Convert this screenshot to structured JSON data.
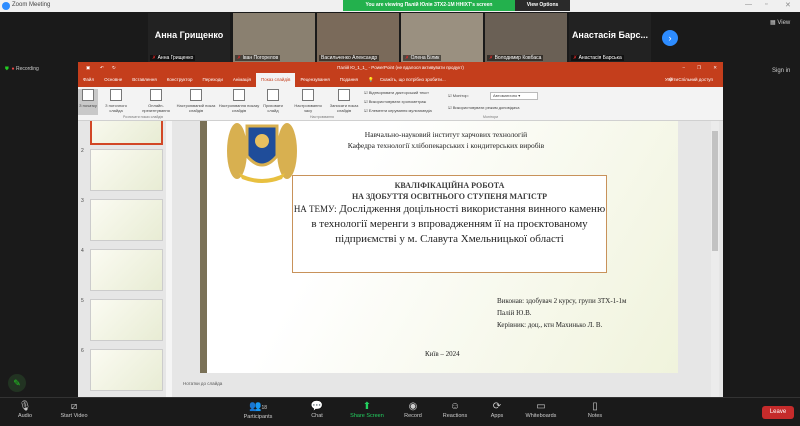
{
  "window": {
    "title": "Zoom Meeting",
    "banner": "You are viewing Палій Юлія ЗТХ2-1М ННІХТ's screen",
    "view_options": "View Options"
  },
  "gallery": {
    "tiles": [
      {
        "big": "Анна Грищенко",
        "name": "Анна Грищенко",
        "muted": true
      },
      {
        "name": "Іван Погорелов",
        "muted": true
      },
      {
        "name": "Васильченко Александр",
        "muted": false
      },
      {
        "name": "Олена Білик",
        "muted": true
      },
      {
        "name": "Володимир Ковбаса",
        "muted": true
      },
      {
        "big": "Анастасія Барс...",
        "name": "Анастасія Барська",
        "muted": true
      }
    ],
    "view_label": "View"
  },
  "status": {
    "recording": "Recording",
    "sign_in": "Sign in"
  },
  "ppt": {
    "title": "Палій Ю_1_1_ - PowerPoint (не вдалося активувати продукт)",
    "tabs": [
      "Файл",
      "Основне",
      "Вставлення",
      "Конструктор",
      "Переходи",
      "Анімація",
      "Показ слайдів",
      "Рецензування",
      "Подання"
    ],
    "tell_me": "Скажіть, що потрібно зробити...",
    "sign_in": "Увійти",
    "share": "Спільний доступ",
    "ribbon": {
      "buttons": [
        "З початку",
        "З поточного слайда",
        "Онлайн-презентування",
        "Настроюваний показ слайдів",
        "Настроювання показу слайдів",
        "Приховати слайд",
        "Настроювання часу",
        "Записати показ слайдів"
      ],
      "checks": [
        "Відтворювати дикторський текст",
        "Використовувати хронометраж",
        "Елементи керування мультимедіа"
      ],
      "monitor_label": "Монітор:",
      "monitor_value": "Автоматично",
      "presenter_view": "Використовувати режим доповідача",
      "groups": [
        "Розпочати показ слайдів",
        "Настроювання",
        "Монітори"
      ]
    },
    "thumb_numbers": [
      "2",
      "3",
      "4",
      "5",
      "6"
    ],
    "notes_placeholder": "Нотатки до слайда",
    "slide": {
      "institute": "Навчально-науковий інститут харчових технологій",
      "department": "Кафедра технології хлібопекарських і кондитерських виробів",
      "heading1": "КВАЛІФІКАЦІЙНА РОБОТА",
      "heading2": "НА ЗДОБУТТЯ ОСВІТНЬОГО СТУПЕНЯ МАГІСТР",
      "topic_prefix": "НА ТЕМУ:",
      "topic": "Дослідження доцільності використання винного каменю в технології меренги з впровадженням її на проєктованому підприємстві у м. Славута Хмельницької області",
      "author_line": "Виконав: здобувач 2 курсу, групи ЗТХ-1-1м",
      "author_name": "Палій Ю.В.",
      "supervisor": "Керівник: доц., ктн Махинько Л. В.",
      "city_year": "Київ – 2024"
    }
  },
  "toolbar": {
    "items": [
      "Audio",
      "Start Video",
      "Participants",
      "Chat",
      "Share Screen",
      "Record",
      "Reactions",
      "Apps",
      "Whiteboards",
      "Notes"
    ],
    "participants_count": "18",
    "leave": "Leave"
  }
}
